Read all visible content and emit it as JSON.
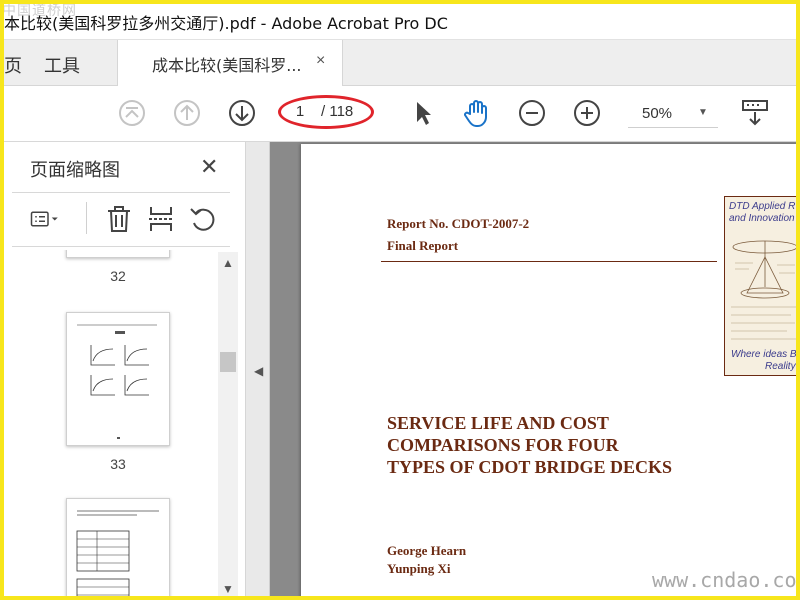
{
  "window": {
    "title": "本比较(美国科罗拉多州交通厅).pdf - Adobe Acrobat Pro DC",
    "watermark_top": "中国道桥网",
    "watermark_bottom": "www.cndao.com"
  },
  "tabs": {
    "partial_tab": "页",
    "tools_tab": "工具",
    "doc_tab": "成本比较(美国科罗...",
    "doc_tab_close": "×"
  },
  "toolbar": {
    "first_page_icon": "first-page-icon",
    "prev_page_icon": "previous-page-icon",
    "next_page_icon": "next-page-icon",
    "current_page": "1",
    "total_pages": "/ 118",
    "select_icon": "arrow-pointer-icon",
    "hand_icon": "hand-icon",
    "zoom_out_icon": "zoom-out-icon",
    "zoom_in_icon": "zoom-in-icon",
    "zoom_value": "50%",
    "fit_icon": "scroll-mode-icon",
    "annotation_color": "#e0242b",
    "hand_color": "#1a73c8"
  },
  "sidebar": {
    "heading": "页面缩略图",
    "close": "✕",
    "tools": [
      "options-menu-icon",
      "delete-icon",
      "extract-pages-icon",
      "rotate-icon"
    ],
    "thumbnails": [
      {
        "page_label": "32"
      },
      {
        "page_label": "33"
      },
      {
        "page_label": ""
      }
    ]
  },
  "document": {
    "report_no": "Report No. CDOT-2007-2",
    "final_report": "Final Report",
    "title_lines": [
      "SERVICE LIFE AND COST",
      "COMPARISONS FOR FOUR",
      "TYPES OF CDOT BRIDGE DECKS"
    ],
    "authors": [
      "George Hearn",
      "Yunping Xi"
    ],
    "logo_lines": [
      "DTD Applied R",
      "and Innovation",
      "Where ideas B",
      "Reality"
    ],
    "text_color": "#6b2a12"
  }
}
